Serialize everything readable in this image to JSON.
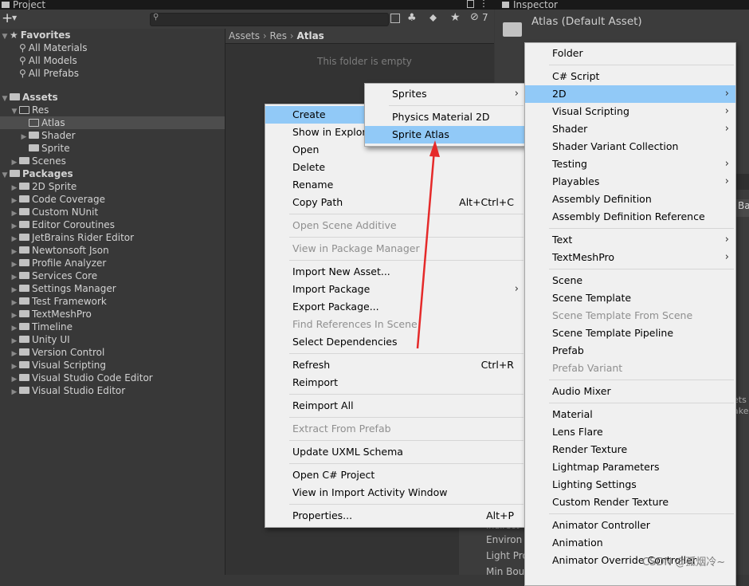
{
  "project_tab": {
    "title": "Project"
  },
  "inspector_tab": {
    "title": "Inspector",
    "asset_title": "Atlas (Default Asset)"
  },
  "toolbar": {
    "add_label": "+",
    "hidden_count": "7"
  },
  "breadcrumb": {
    "part1": "Assets",
    "part2": "Res",
    "part3": "Atlas"
  },
  "main": {
    "empty_text": "This folder is empty"
  },
  "tree": {
    "favorites_label": "Favorites",
    "fav_items": [
      "All Materials",
      "All Models",
      "All Prefabs"
    ],
    "assets_label": "Assets",
    "res_label": "Res",
    "res_children": [
      "Atlas",
      "Shader",
      "Sprite"
    ],
    "scenes_label": "Scenes",
    "packages_label": "Packages",
    "packages": [
      "2D Sprite",
      "Code Coverage",
      "Custom NUnit",
      "Editor Coroutines",
      "JetBrains Rider Editor",
      "Newtonsoft Json",
      "Profile Analyzer",
      "Services Core",
      "Settings Manager",
      "Test Framework",
      "TextMeshPro",
      "Timeline",
      "Unity UI",
      "Version Control",
      "Visual Scripting",
      "Visual Studio Code Editor",
      "Visual Studio Editor"
    ]
  },
  "context_menu": {
    "create": "Create",
    "show_in_explorer": "Show in Explorer",
    "open": "Open",
    "delete": "Delete",
    "rename": "Rename",
    "copy_path": "Copy Path",
    "copy_path_shortcut": "Alt+Ctrl+C",
    "open_scene_additive": "Open Scene Additive",
    "view_in_package_manager": "View in Package Manager",
    "import_new_asset": "Import New Asset...",
    "import_package": "Import Package",
    "export_package": "Export Package...",
    "find_references": "Find References In Scene",
    "select_dependencies": "Select Dependencies",
    "refresh": "Refresh",
    "refresh_shortcut": "Ctrl+R",
    "reimport": "Reimport",
    "reimport_all": "Reimport All",
    "extract_from_prefab": "Extract From Prefab",
    "update_uxml": "Update UXML Schema",
    "open_csharp_project": "Open C# Project",
    "view_import_activity": "View in Import Activity Window",
    "properties": "Properties...",
    "properties_shortcut": "Alt+P"
  },
  "submenu_2d": {
    "sprites": "Sprites",
    "physics_material_2d": "Physics Material 2D",
    "sprite_atlas": "Sprite Atlas"
  },
  "create_menu": {
    "folder": "Folder",
    "csharp_script": "C# Script",
    "two_d": "2D",
    "visual_scripting": "Visual Scripting",
    "shader": "Shader",
    "shader_variant_collection": "Shader Variant Collection",
    "testing": "Testing",
    "playables": "Playables",
    "assembly_definition": "Assembly Definition",
    "assembly_definition_reference": "Assembly Definition Reference",
    "text": "Text",
    "textmeshpro": "TextMeshPro",
    "scene": "Scene",
    "scene_template": "Scene Template",
    "scene_template_from_scene": "Scene Template From Scene",
    "scene_template_pipeline": "Scene Template Pipeline",
    "prefab": "Prefab",
    "prefab_variant": "Prefab Variant",
    "audio_mixer": "Audio Mixer",
    "material": "Material",
    "lens_flare": "Lens Flare",
    "render_texture": "Render Texture",
    "lightmap_parameters": "Lightmap Parameters",
    "lighting_settings": "Lighting Settings",
    "custom_render_texture": "Custom Render Texture",
    "animator_controller": "Animator Controller",
    "animation": "Animation",
    "animator_override_controller": "Animator Override Controller"
  },
  "background_fragments": {
    "ba": "Ba",
    "ets": "ets",
    "ake": "ake",
    "environ": "Environ",
    "light_pro": "Light Pro",
    "min_bou": "Min Bou",
    "indirect": "Indirect"
  },
  "watermark": "CSDN @孤烟冷~",
  "colors": {
    "menu_bg": "#f0f0f0",
    "highlight": "#91c9f7",
    "arrow": "#e52a2a",
    "editor_bg": "#383838"
  }
}
